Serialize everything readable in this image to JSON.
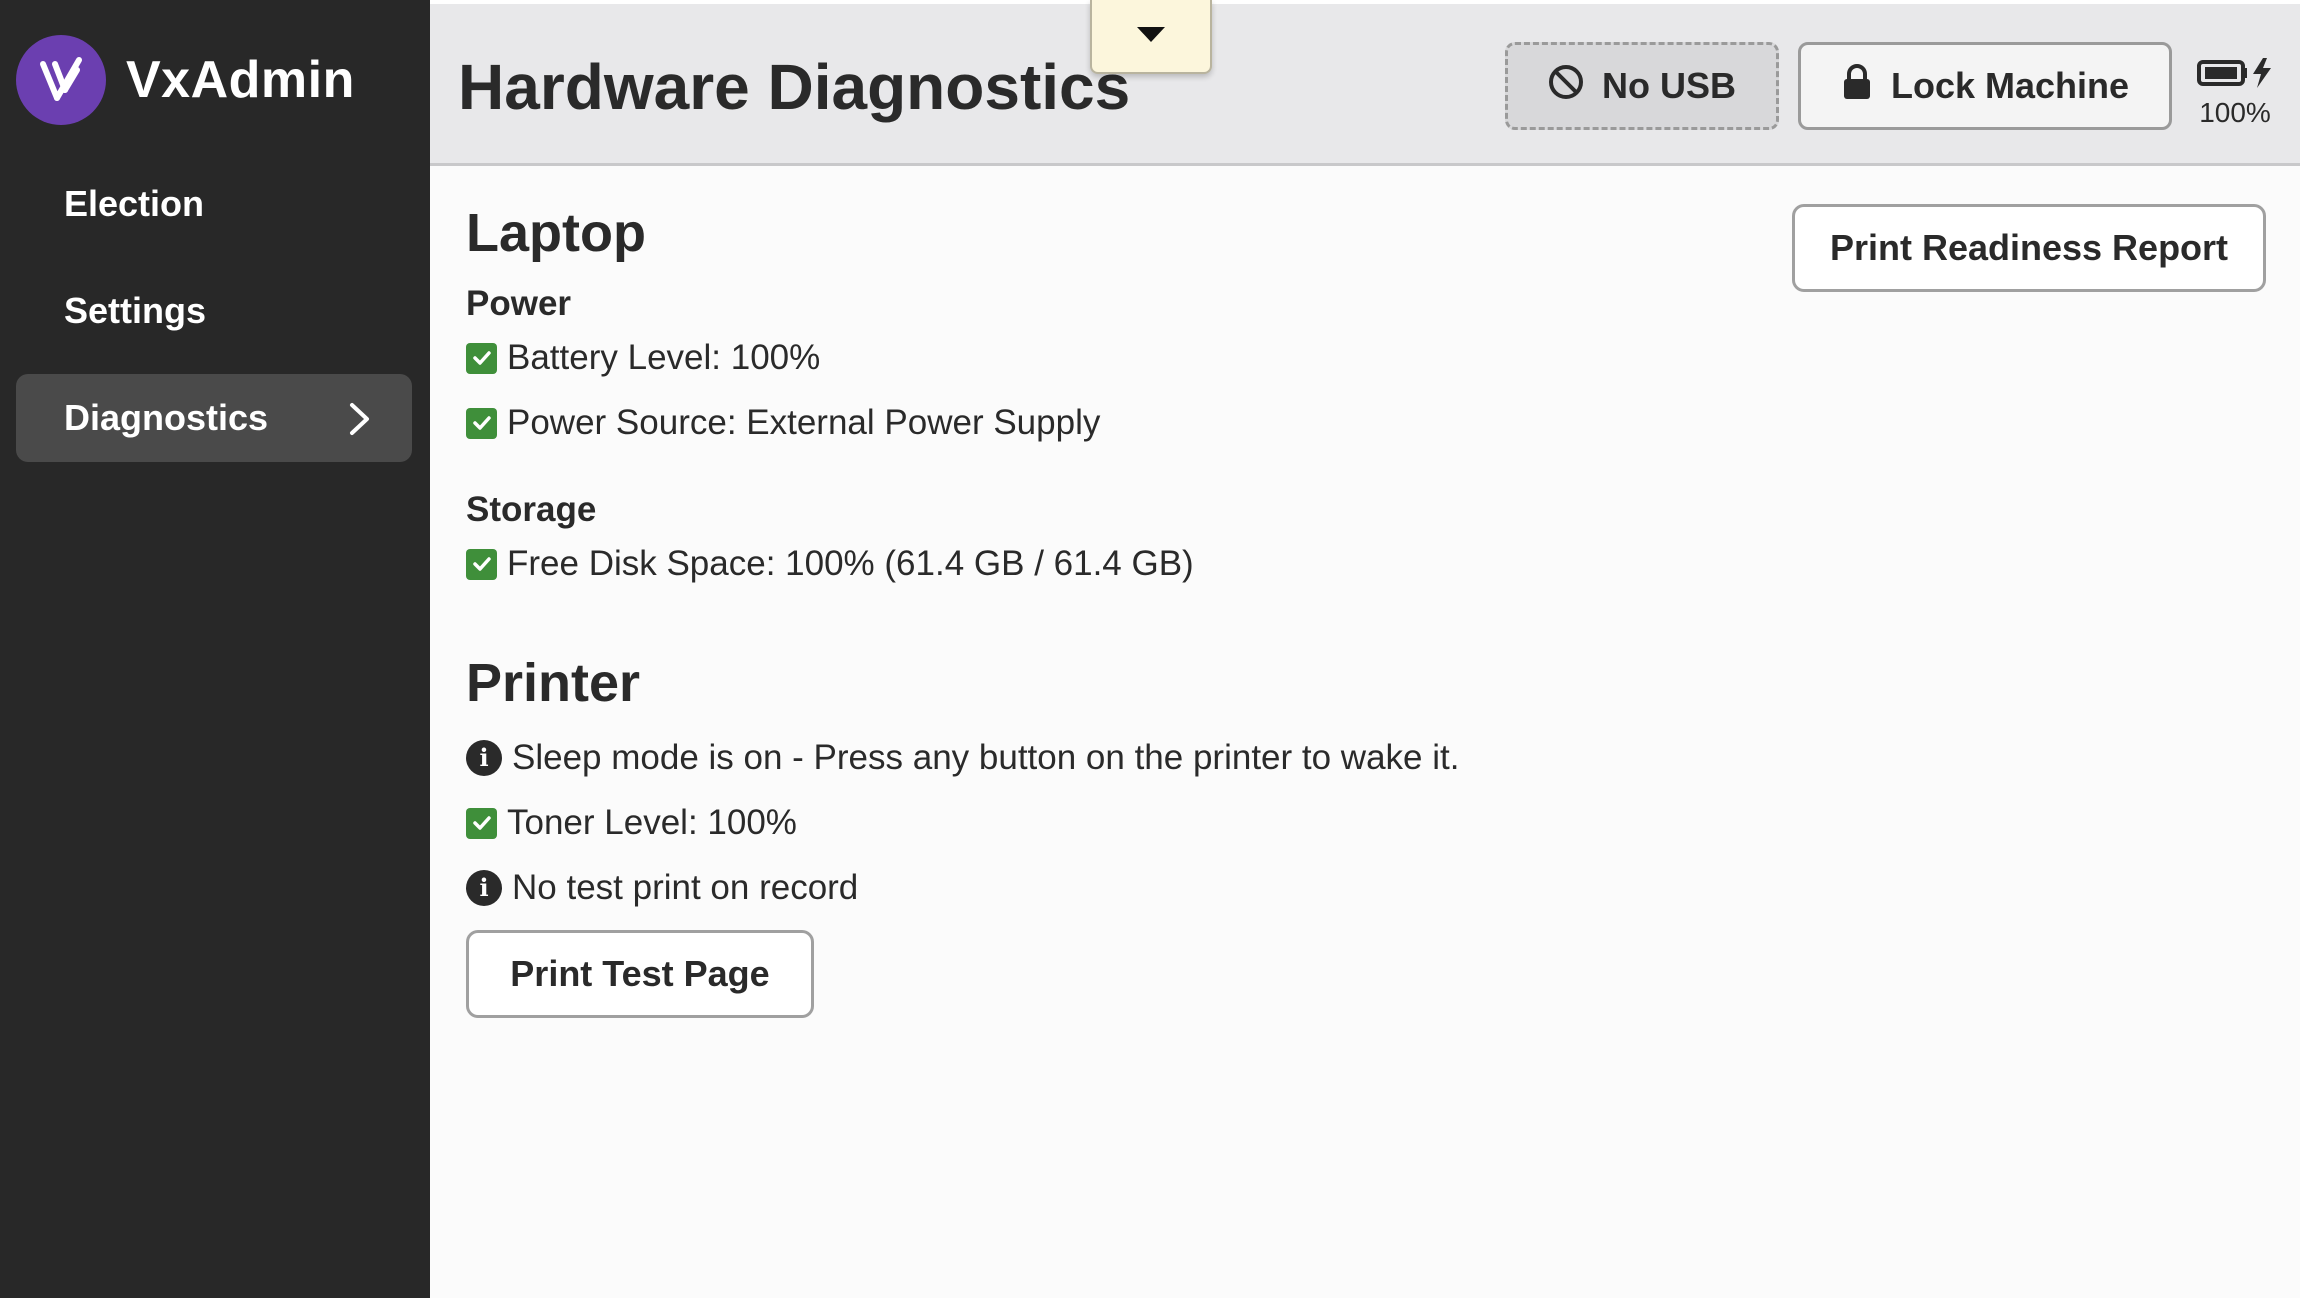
{
  "app": {
    "name": "VxAdmin"
  },
  "sidebar": {
    "items": [
      {
        "label": "Election",
        "active": false
      },
      {
        "label": "Settings",
        "active": false
      },
      {
        "label": "Diagnostics",
        "active": true
      }
    ]
  },
  "header": {
    "title": "Hardware Diagnostics",
    "usb_label": "No USB",
    "lock_label": "Lock Machine",
    "battery_percent": "100%",
    "dev_dock_icon": "caret-down-icon"
  },
  "main": {
    "print_report_label": "Print Readiness Report",
    "laptop": {
      "title": "Laptop",
      "power": {
        "title": "Power",
        "battery": "Battery Level: 100%",
        "source": "Power Source: External Power Supply"
      },
      "storage": {
        "title": "Storage",
        "disk": "Free Disk Space: 100% (61.4 GB / 61.4 GB)"
      }
    },
    "printer": {
      "title": "Printer",
      "sleep": "Sleep mode is on - Press any button on the printer to wake it.",
      "toner": "Toner Level: 100%",
      "test_print": "No test print on record",
      "print_test_label": "Print Test Page"
    }
  },
  "colors": {
    "sidebar_bg": "#282828",
    "brand_purple": "#6b3fb0",
    "success_green": "#3f8f3a",
    "header_bg": "#e8e8ea"
  }
}
